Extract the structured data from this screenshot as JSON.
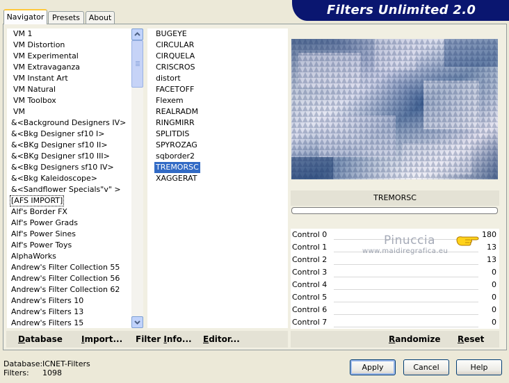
{
  "window": {
    "title": "Filters Unlimited 2.0"
  },
  "tabs": [
    {
      "label": "Navigator",
      "active": true
    },
    {
      "label": "Presets",
      "active": false
    },
    {
      "label": "About",
      "active": false
    }
  ],
  "categories": [
    "VM 1",
    "VM Distortion",
    "VM Experimental",
    "VM Extravaganza",
    "VM Instant Art",
    "VM Natural",
    "VM Toolbox",
    "VM",
    "&<Background Designers IV>",
    "&<Bkg Designer sf10 I>",
    "&<BKg Designer sf10 II>",
    "&<BKg Designer sf10 III>",
    "&<Bkg Designers sf10 IV>",
    "&<Bkg Kaleidoscope>",
    "&<Sandflower Specials\"v\" >",
    "[AFS IMPORT]",
    "Alf's Border FX",
    "Alf's Power Grads",
    "Alf's Power Sines",
    "Alf's Power Toys",
    "AlphaWorks",
    "Andrew's Filter Collection 55",
    "Andrew's Filter Collection 56",
    "Andrew's Filter Collection 62",
    "Andrew's Filters 10",
    "Andrew's Filters 13",
    "Andrew's Filters 15"
  ],
  "categories_boxed_index": 15,
  "filters": [
    "BUGEYE",
    "CIRCULAR",
    "CIRQUELA",
    "CRISCROS",
    "distort",
    "FACETOFF",
    "Flexem",
    "REALRADM",
    "RINGMIRR",
    "SPLITDIS",
    "SPYROZAG",
    "sqborder2",
    "TREMORSC",
    "XAGGERAT"
  ],
  "filters_selected_index": 12,
  "selected_filter_name": "TREMORSC",
  "controls": [
    {
      "label": "Control 0",
      "value": "180"
    },
    {
      "label": "Control 1",
      "value": "13"
    },
    {
      "label": "Control 2",
      "value": "13"
    },
    {
      "label": "Control 3",
      "value": "0"
    },
    {
      "label": "Control 4",
      "value": "0"
    },
    {
      "label": "Control 5",
      "value": "0"
    },
    {
      "label": "Control 6",
      "value": "0"
    },
    {
      "label": "Control 7",
      "value": "0"
    }
  ],
  "watermark": {
    "name": "Pinuccia",
    "url": "www.maidiregrafica.eu"
  },
  "toolbar": {
    "database": {
      "label": "atabase",
      "accel": "D"
    },
    "import": {
      "label": "mport...",
      "prefix": "",
      "accel": "I"
    },
    "filter_info": {
      "label": "Filter ",
      "accel": "I",
      "suffix": "nfo..."
    },
    "editor": {
      "label": "ditor...",
      "accel": "E"
    },
    "randomize": {
      "label": "andomize",
      "accel": "R"
    },
    "reset": {
      "label": "eset",
      "accel": "R"
    }
  },
  "status": {
    "database_label": "Database:",
    "database_value": "ICNET-Filters",
    "filters_label": "Filters:",
    "filters_value": "1098"
  },
  "buttons": {
    "apply": "Apply",
    "cancel": "Cancel",
    "help": "Help"
  },
  "colors": {
    "banner": "#0a1670",
    "selection": "#316ac5",
    "window_bg": "#ece9d8"
  }
}
